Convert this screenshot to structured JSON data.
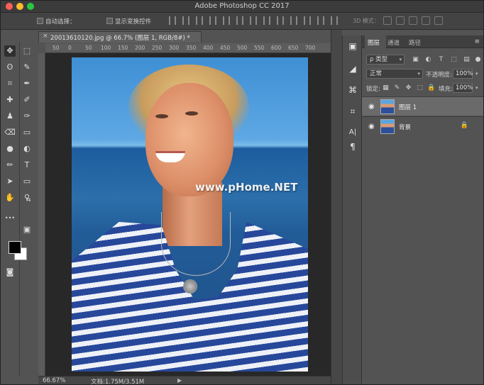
{
  "app": {
    "title": "Adobe Photoshop CC 2017"
  },
  "options_bar": {
    "auto_select_label": "自动选择：",
    "show_transform_label": "显示变换控件",
    "mode_3d_label": "3D 模式："
  },
  "document": {
    "tab_title": "20013610120.jpg @ 66.7% (图层 1, RGB/8#) *",
    "close_glyph": "×",
    "ruler_labels": [
      "50",
      "0",
      "50",
      "100",
      "150",
      "200",
      "250",
      "300",
      "350",
      "400",
      "450",
      "500",
      "550",
      "600",
      "650",
      "700"
    ],
    "watermark": "www.pHome.NET"
  },
  "status": {
    "zoom": "66.67%",
    "doc_size": "文档:1.75M/3.51M",
    "arrow": "▶"
  },
  "tools": {
    "move": "✥",
    "marquee": "⬚",
    "lasso": "ʘ",
    "quick_select": "✎",
    "crop": "⌗",
    "eyedropper": "✒",
    "healing": "✚",
    "brush": "✐",
    "stamp": "♟",
    "history": "✑",
    "eraser": "⌫",
    "gradient": "▭",
    "blur": "●",
    "dodge": "◐",
    "pen": "✏",
    "type": "T",
    "path_select": "➤",
    "shape": "▭",
    "hand": "✋",
    "zoom": "⚲",
    "more": "•••",
    "swap_colors": "⇆",
    "quick_mask": "◙",
    "screen_mode": "▣"
  },
  "side_strip": {
    "history": "▣",
    "adjust": "◢",
    "transform": "⌘",
    "crop": "⌗",
    "char": "A|",
    "para": "¶"
  },
  "panel": {
    "tabs": [
      "图层",
      "通道",
      "路径"
    ],
    "menu_glyph": "≡",
    "filter": {
      "search_glyph": "ρ",
      "value": "类型",
      "caret": "▾"
    },
    "filter_icons": [
      "▣",
      "◐",
      "T",
      "⬚",
      "▤",
      "●"
    ],
    "blend_mode": {
      "value": "正常",
      "caret": "▾"
    },
    "opacity": {
      "label": "不透明度:",
      "value": "100%",
      "caret": "▾"
    },
    "lock": {
      "label": "锁定:",
      "icons": [
        "▦",
        "✎",
        "✥",
        "⬚",
        "🔒"
      ]
    },
    "fill": {
      "label": "填充:",
      "value": "100%",
      "caret": "▾"
    },
    "layers": [
      {
        "name": "图层 1",
        "eye": "◉",
        "lock": "",
        "selected": true
      },
      {
        "name": "背景",
        "eye": "◉",
        "lock": "🔒",
        "selected": false
      }
    ]
  }
}
